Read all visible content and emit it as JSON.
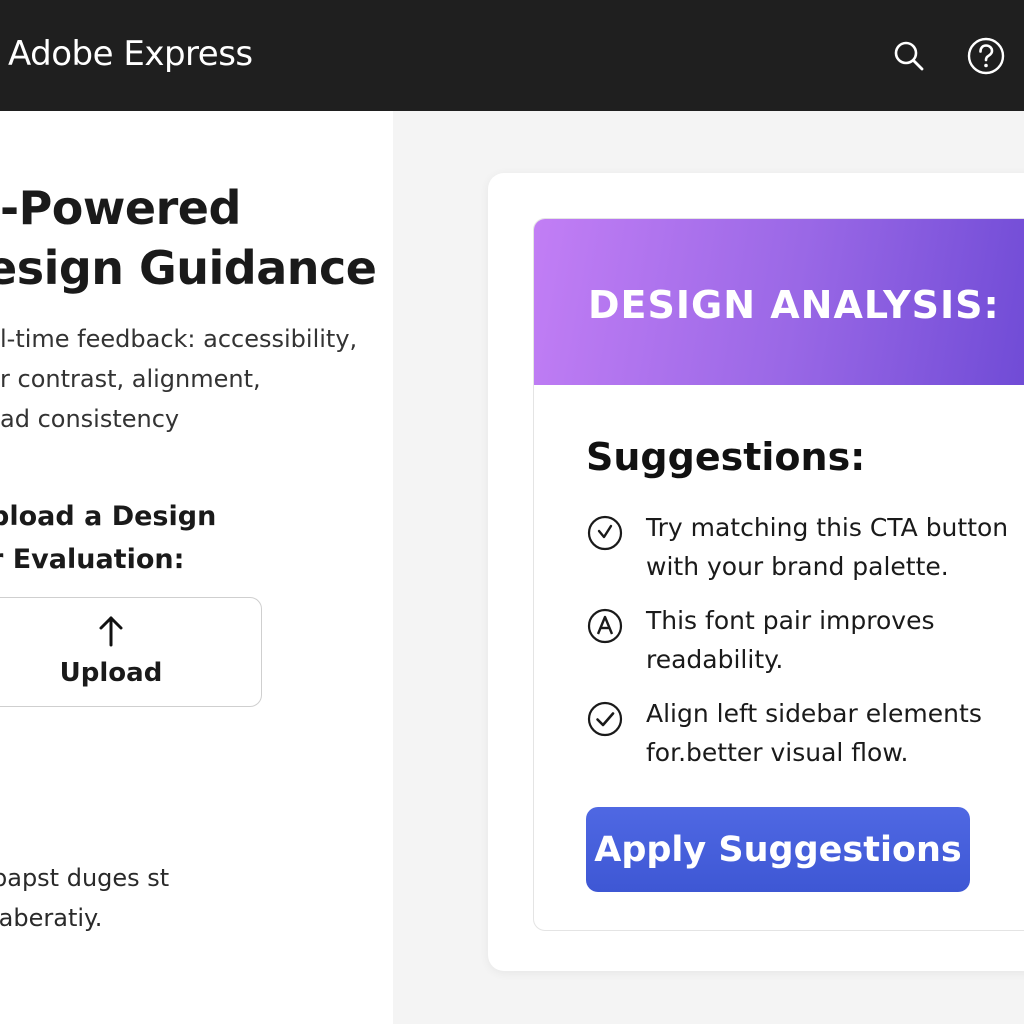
{
  "header": {
    "app_title": "Adobe Express",
    "search_icon": "search-icon",
    "help_icon": "help-icon"
  },
  "left_panel": {
    "hero_line_1": "-Powered",
    "hero_line_2": "esign Guidance",
    "description_lines": [
      "l-time feedback: accessibility,",
      "r contrast, alignment,",
      "ad consistency"
    ],
    "upload_prompt_lines": [
      "pload a Design",
      "r Evaluation:"
    ],
    "upload_button_label": "Upload",
    "upload_icon": "upload-arrow-icon",
    "footer_lines": [
      "papst duges st",
      "laberatiy."
    ]
  },
  "analysis_card": {
    "header_title": "DESIGN ANALYSIS:",
    "suggestions_heading": "Suggestions:",
    "suggestions": [
      {
        "icon": "clock-check-icon",
        "line1": "Try matching this CTA button",
        "line2": "with your brand palette."
      },
      {
        "icon": "font-a-icon",
        "line1": "This font pair improves",
        "line2": "readability."
      },
      {
        "icon": "check-circle-icon",
        "line1": "Align left sidebar elements",
        "line2": "for.better visual flow."
      }
    ],
    "apply_button_label": "Apply Suggestions"
  },
  "colors": {
    "topbar": "#1f1f1f",
    "header_gradient_start": "#c27ef5",
    "header_gradient_end": "#6b48d4",
    "apply_button": "#4560db"
  }
}
